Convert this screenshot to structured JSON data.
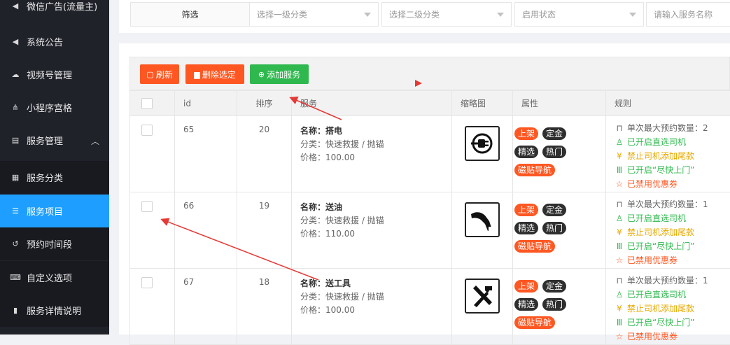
{
  "sidebar": {
    "items": [
      {
        "icon": "speaker-icon",
        "glyph": "◀",
        "label": "微信广告(流量主)"
      },
      {
        "icon": "speaker-icon",
        "glyph": "◀",
        "label": "系统公告"
      },
      {
        "icon": "cloud-upload-icon",
        "glyph": "☁",
        "label": "视频号管理"
      },
      {
        "icon": "sitemap-icon",
        "glyph": "⋔",
        "label": "小程序宫格"
      },
      {
        "icon": "list-icon",
        "glyph": "▤",
        "label": "服务管理"
      },
      {
        "icon": "grid-icon",
        "glyph": "▦",
        "label": "服务分类"
      },
      {
        "icon": "list-icon",
        "glyph": "☰",
        "label": "服务项目"
      },
      {
        "icon": "history-icon",
        "glyph": "↺",
        "label": "预约时间段"
      },
      {
        "icon": "keyboard-icon",
        "glyph": "⌨",
        "label": "自定义选项"
      },
      {
        "icon": "file-icon",
        "glyph": "▮",
        "label": "服务详情说明"
      }
    ]
  },
  "filter": {
    "label": "筛选",
    "category1_placeholder": "选择一级分类",
    "category2_placeholder": "选择二级分类",
    "status_placeholder": "启用状态",
    "search_placeholder": "请输入服务名称"
  },
  "toolbar": {
    "refresh": "刷新",
    "delete_selected": "删除选定",
    "add_service": "添加服务"
  },
  "table": {
    "headers": {
      "id": "id",
      "sort": "排序",
      "service": "服务",
      "thumb": "缩略图",
      "attr": "属性",
      "rule": "规则"
    },
    "rows": [
      {
        "id": "65",
        "sort": "20",
        "name_label": "名称：",
        "name": "搭电",
        "category": "分类：快速救援 / 抛锚",
        "price": "价格：100.00",
        "thumb_icon": "plug-icon",
        "tags": [
          "上架",
          "定金",
          "精选",
          "热门",
          "磁贴导航"
        ],
        "rules": [
          "单次最大预约数量：2",
          "已开启直选司机",
          "禁止司机添加尾款",
          "已开启“尽快上门”",
          "已禁用优惠券"
        ]
      },
      {
        "id": "66",
        "sort": "19",
        "name_label": "名称：",
        "name": "送油",
        "category": "分类：快速救援 / 抛锚",
        "price": "价格：110.00",
        "thumb_icon": "fuel-nozzle-icon",
        "tags": [
          "上架",
          "定金",
          "精选",
          "热门",
          "磁贴导航"
        ],
        "rules": [
          "单次最大预约数量：1",
          "已开启直选司机",
          "禁止司机添加尾款",
          "已开启“尽快上门”",
          "已禁用优惠券"
        ]
      },
      {
        "id": "67",
        "sort": "18",
        "name_label": "名称：",
        "name": "送工具",
        "category": "分类：快速救援 / 抛锚",
        "price": "价格：100.00",
        "thumb_icon": "tools-icon",
        "tags": [
          "上架",
          "定金",
          "精选",
          "热门",
          "磁贴导航"
        ],
        "rules": [
          "单次最大预约数量：1",
          "已开启直选司机",
          "禁止司机添加尾款",
          "已开启“尽快上门”",
          "已禁用优惠券"
        ]
      }
    ]
  },
  "colors": {
    "accent": "#1e9fff",
    "orange": "#ff5722",
    "green": "#2fb84e",
    "dark_tag": "#2f2f2f",
    "sidebar_bg": "#20222a",
    "annotation_red": "#e53935"
  }
}
